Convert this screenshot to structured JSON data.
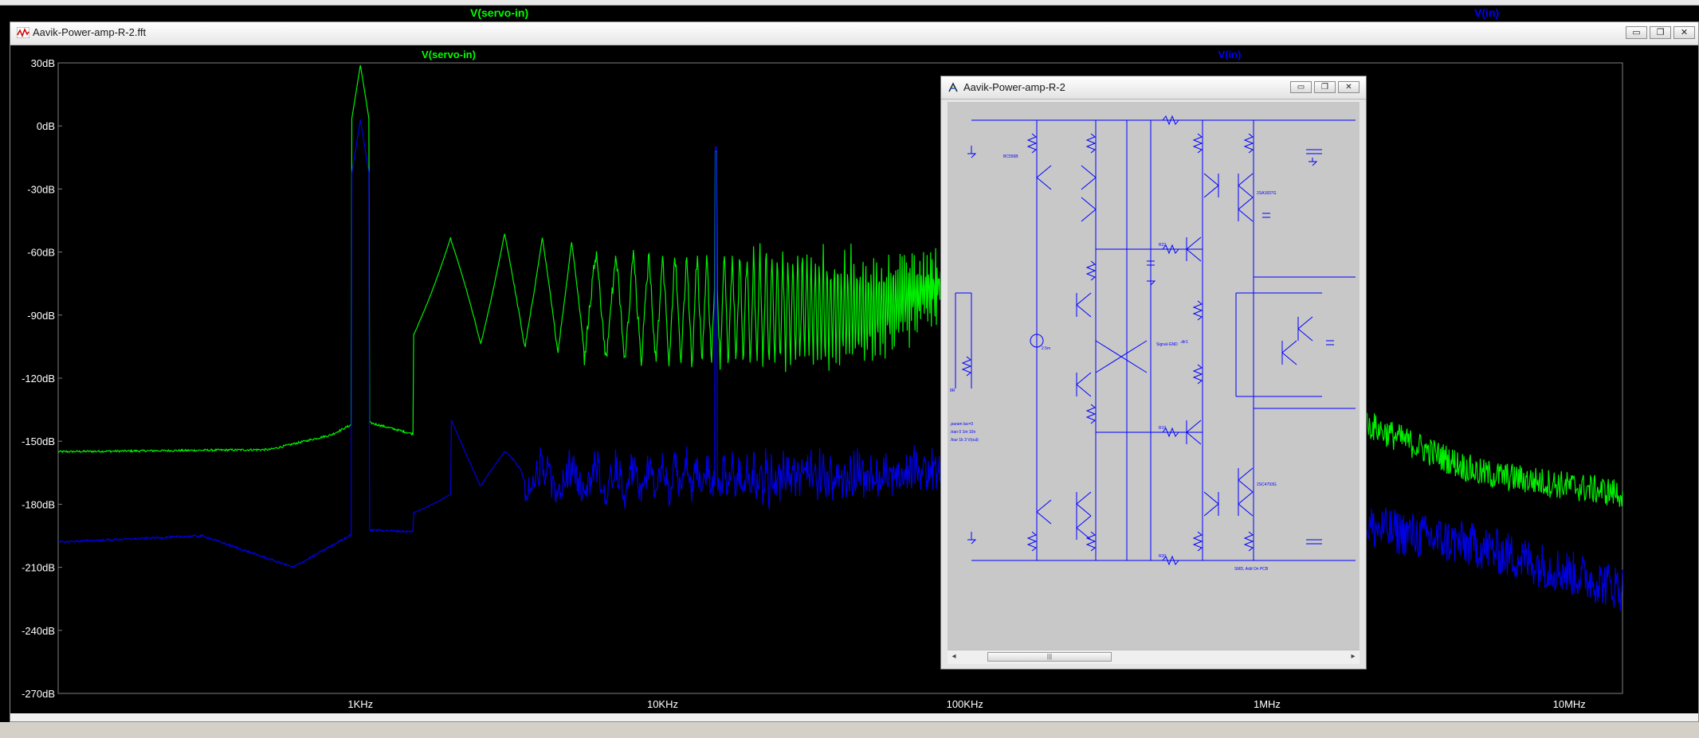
{
  "background_window": {
    "trace_labels": [
      {
        "text": "V(servo-in)",
        "color": "#00ff00"
      },
      {
        "text": "V(in)",
        "color": "#0000ff"
      }
    ]
  },
  "main_window": {
    "title": "Aavik-Power-amp-R-2.fft",
    "icon": "waveform-icon",
    "buttons": {
      "minimize": "▭",
      "restore": "❐",
      "close": "✕"
    }
  },
  "plot": {
    "trace_labels": [
      {
        "text": "V(servo-in)",
        "color": "#00ff00"
      },
      {
        "text": "V(in)",
        "color": "#0000ff"
      }
    ]
  },
  "chart_data": {
    "type": "line",
    "x_scale": "log",
    "xlim": [
      100,
      15000000
    ],
    "ylim": [
      -270,
      30
    ],
    "y_ticks": [
      "30dB",
      "0dB",
      "-30dB",
      "-60dB",
      "-90dB",
      "-120dB",
      "-150dB",
      "-180dB",
      "-210dB",
      "-240dB",
      "-270dB"
    ],
    "x_ticks": [
      "1KHz",
      "10KHz",
      "100KHz",
      "1MHz",
      "10MHz"
    ],
    "x_tick_values": [
      1000,
      10000,
      100000,
      1000000,
      10000000
    ],
    "grid": false,
    "series": [
      {
        "name": "V(servo-in)",
        "color": "#00ff00",
        "noise_floor_db": [
          [
            100,
            -155
          ],
          [
            500,
            -154
          ],
          [
            800,
            -147
          ],
          [
            1000,
            -140
          ],
          [
            3000,
            -158
          ],
          [
            10000,
            -168
          ],
          [
            50000,
            -172
          ],
          [
            100000,
            -168
          ],
          [
            2000000,
            -140
          ],
          [
            5000000,
            -165
          ],
          [
            15000000,
            -175
          ]
        ],
        "harmonics": {
          "fundamental_hz": 1000,
          "fundamental_db": 29,
          "peaks_db": [
            [
              2000,
              -55
            ],
            [
              3000,
              -51
            ],
            [
              4000,
              -53
            ],
            [
              5000,
              -55
            ],
            [
              15000,
              -12
            ],
            [
              20000,
              -58
            ],
            [
              50000,
              -50
            ],
            [
              100000,
              -52
            ]
          ]
        }
      },
      {
        "name": "V(in)",
        "color": "#0000ff",
        "noise_floor_db": [
          [
            100,
            -198
          ],
          [
            300,
            -195
          ],
          [
            600,
            -210
          ],
          [
            1000,
            -192
          ],
          [
            3000,
            -195
          ],
          [
            10000,
            -192
          ],
          [
            100000,
            -185
          ],
          [
            2000000,
            -190
          ],
          [
            5000000,
            -200
          ],
          [
            15000000,
            -220
          ]
        ],
        "harmonics": {
          "fundamental_hz": 1000,
          "fundamental_db": 3,
          "peaks_db": [
            [
              2000,
              -130
            ],
            [
              3000,
              -145
            ],
            [
              15000,
              -10
            ],
            [
              100000,
              -165
            ]
          ]
        }
      }
    ]
  },
  "schematic_window": {
    "title": "Aavik-Power-amp-R-2",
    "icon": "schematic-icon",
    "buttons": {
      "minimize": "▭",
      "restore": "❐",
      "close": "✕"
    },
    "scroll_left": "◂",
    "scroll_right": "▸",
    "scroll_grip": "|||",
    "labels": {
      "bc546b_top": "BC556B",
      "sig": "Signal-GND",
      "dir1": ".dir1",
      "note": "SMD, Add On PCB",
      "spice1": ".param lac=3",
      "spice2": ".tran 0 1m 10n",
      "spice3": ".four 1k 3 V(out)",
      "zsa": "2SA1837G",
      "zsc": "2SC4793G",
      "iset": "2.5m",
      "rload": "8R",
      "ra": "R22",
      "rb": "R19",
      "rc": "R20"
    }
  }
}
